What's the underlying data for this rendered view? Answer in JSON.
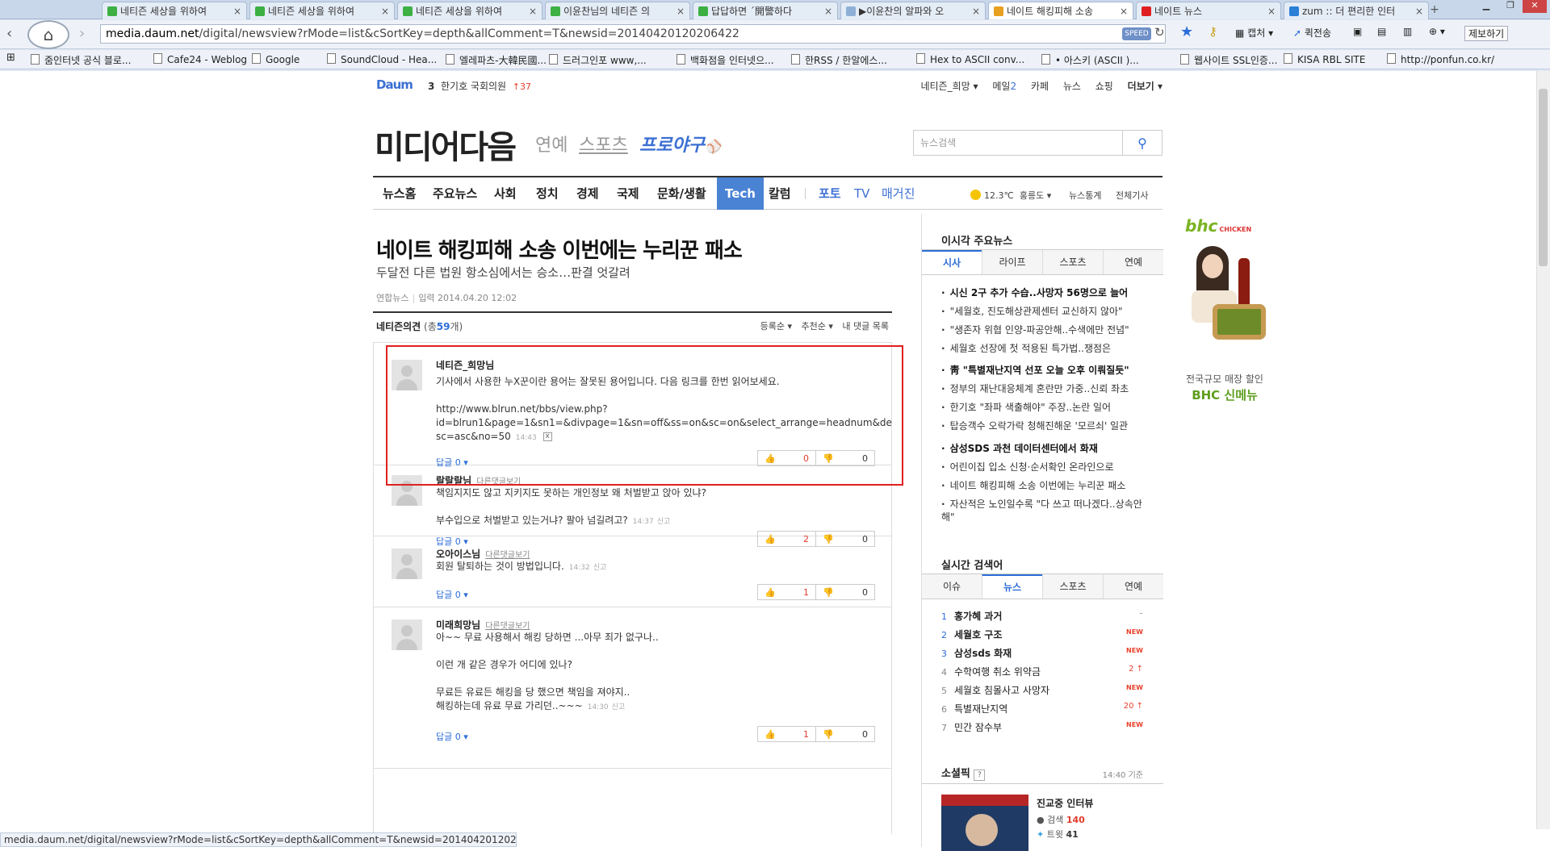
{
  "browser": {
    "tabs": [
      {
        "title": "네티즌 세상을 위하여",
        "color": "#3cb043"
      },
      {
        "title": "네티즌 세상을 위하여",
        "color": "#3cb043"
      },
      {
        "title": "네티즌 세상을 위하여",
        "color": "#3cb043"
      },
      {
        "title": "이윤찬님의 네티즌 의",
        "color": "#3cb043"
      },
      {
        "title": "답답하면 ´開警하다",
        "color": "#3cb043"
      },
      {
        "title": "▶이윤찬의 알파와 오",
        "color": "#8fb0d6"
      },
      {
        "title": "네이트 해킹피해 소송",
        "color": "#e8a020"
      },
      {
        "title": "네이트 뉴스",
        "color": "#e02020"
      },
      {
        "title": "zum :: 더 편리한 인터",
        "color": "#2a7fd6"
      }
    ],
    "url_host": "media.daum.net",
    "url_path": "/digital/newsview?rMode=list&cSortKey=depth&allComment=T&newsid=20140420120206422",
    "speed_label": "SPEED",
    "toolbar": {
      "capture": "캡처",
      "quick_send": "퀵전송",
      "report": "제보하기"
    },
    "bookmarks": [
      "줌인터넷 공식 블로...",
      "Cafe24 - Weblog",
      "Google",
      "SoundCloud - Hea...",
      "엘레파츠-大韓民國...",
      "드러그인포 www,...",
      "백화점을 인터넷으...",
      "한RSS / 한알에스...",
      "Hex to ASCII conv...",
      "• 아스키 (ASCII )...",
      "웹사이트 SSL인증...",
      "KISA RBL SITE",
      "http://ponfun.co.kr/"
    ],
    "status_url": "media.daum.net/digital/newsview?rMode=list&cSortKey=depth&allComment=T&newsid=20140420120206422#"
  },
  "daum": {
    "logo": "Daum",
    "issue_rank": "3",
    "issue_text": "한기호 국회의원",
    "issue_change": "↑37",
    "toplinks": {
      "user": "네티즌_희망 ▾",
      "mail": "메일",
      "mail_count": "2",
      "cafe": "카페",
      "news": "뉴스",
      "shopping": "쇼핑",
      "more": "더보기 ▾"
    }
  },
  "brand": {
    "title": "미디어다음",
    "entertainment": "연예",
    "sports": "스포츠",
    "baseball": "프로야구"
  },
  "search": {
    "placeholder": "뉴스검색"
  },
  "gnb": {
    "items": [
      "뉴스홈",
      "주요뉴스",
      "사회",
      "정치",
      "경제",
      "국제",
      "문화/생활",
      "Tech",
      "칼럼",
      "포토",
      "TV",
      "매거진"
    ],
    "weather": "12.3℃",
    "region": "홍릉도 ▾",
    "stats": "뉴스통계",
    "all": "전체기사"
  },
  "article": {
    "title": "네이트 해킹피해 소송 이번에는 누리꾼 패소",
    "subtitle": "두달전 다른 법원 항소심에서는 승소…판결 엇갈려",
    "source": "연합뉴스",
    "date_label": "입력",
    "date": "2014.04.20 12:02"
  },
  "comments_header": {
    "label": "네티즌의견",
    "count_prefix": "(총",
    "count": "59",
    "count_suffix": "개)",
    "sort_reg": "등록순 ▾",
    "sort_rec": "추천순 ▾",
    "my": "내 댓글 목록"
  },
  "comments": [
    {
      "name": "네티즌_희망님",
      "more": "",
      "text": "기사에서 사용한 누X꾼이란 용어는 잘못된 용어입니다. 다음 링크를 한번 읽어보세요.\n\nhttp://www.blrun.net/bbs/view.php?\nid=blrun1&page=1&sn1=&divpage=1&sn=off&ss=on&sc=on&select_arrange=headnum&de\nsc=asc&no=50",
      "time": "14:43",
      "tail": "x",
      "reply": "답글 0 ▾",
      "up": "0",
      "down": "0"
    },
    {
      "name": "랄랄랄님",
      "more": "다른댓글보기",
      "text": "책임지지도 않고 지키지도 못하는 개인정보 왜 처벌받고 앉아 있냐?\n\n부수입으로 처벌받고 있는거냐? 팔아 넘길려고?",
      "time": "14:37",
      "tail": "신고",
      "reply": "답글 0 ▾",
      "up": "2",
      "down": "0"
    },
    {
      "name": "오아이스님",
      "more": "다른댓글보기",
      "text": "회원 탈퇴하는 것이 방법입니다.",
      "time": "14:32",
      "tail": "신고",
      "reply": "답글 0 ▾",
      "up": "1",
      "down": "0"
    },
    {
      "name": "미래희망님",
      "more": "다른댓글보기",
      "text": "아~~ 무료 사용해서 해킹 당하면 ...아무 죄가 없구나..\n\n이런 개 같은 경우가 어디에 있나?\n\n무료든 유료든 해킹을 당 했으면 책임을 져야지..\n해킹하는데 유료 무료 가리던..~~~",
      "time": "14:30",
      "tail": "신고",
      "reply": "답글 0 ▾",
      "up": "1",
      "down": "0"
    }
  ],
  "sidebar": {
    "top_news_title": "이시각 주요뉴스",
    "top_news_tabs": [
      "시사",
      "라이프",
      "스포츠",
      "연예"
    ],
    "top_news": [
      {
        "text": "시신 2구 추가 수습..사망자 56명으로 늘어",
        "bold": true
      },
      {
        "text": "\"세월호, 진도해상관제센터 교신하지 않아\"",
        "bold": false
      },
      {
        "text": "\"생존자 위협 인양-파공안해..수색에만 전념\"",
        "bold": false
      },
      {
        "text": "세월호 선장에 첫 적용된 특가법..쟁점은",
        "bold": false
      },
      {
        "text": "靑 \"특별재난지역 선포 오늘 오후 이뤄질듯\"",
        "bold": true
      },
      {
        "text": "정부의 재난대응체계 혼란만 가중..신뢰 좌초",
        "bold": false
      },
      {
        "text": "한기호 \"좌파 색출해야\" 주장..논란 일어",
        "bold": false
      },
      {
        "text": "탑승객수 오락가락 청해진해운 '모르쇠' 일관",
        "bold": false
      },
      {
        "text": "삼성SDS 과천 데이터센터에서 화재",
        "bold": true
      },
      {
        "text": "어린이집 입소 신청·순서확인 온라인으로",
        "bold": false
      },
      {
        "text": "네이트 해킹피해 소송 이번에는 누리꾼 패소",
        "bold": false
      },
      {
        "text": "자산적은 노인일수록 \"다 쓰고 떠나겠다..상속안해\"",
        "bold": false
      }
    ],
    "realtime_title": "실시간 검색어",
    "realtime_tabs": [
      "이슈",
      "뉴스",
      "스포츠",
      "연예"
    ],
    "realtime": [
      {
        "rank": "1",
        "text": "홍가혜 과거",
        "status": "–",
        "bold": true
      },
      {
        "rank": "2",
        "text": "세월호 구조",
        "status": "NEW",
        "bold": true
      },
      {
        "rank": "3",
        "text": "삼성sds 화재",
        "status": "NEW",
        "bold": true
      },
      {
        "rank": "4",
        "text": "수학여행 취소 위약금",
        "status": "2 ↑",
        "bold": false
      },
      {
        "rank": "5",
        "text": "세월호 침몰사고 사망자",
        "status": "NEW",
        "bold": false
      },
      {
        "rank": "6",
        "text": "특별재난지역",
        "status": "20 ↑",
        "bold": false
      },
      {
        "rank": "7",
        "text": "민간 잠수부",
        "status": "NEW",
        "bold": false
      }
    ],
    "sosul_title": "소셜픽",
    "sosul_help": "?",
    "sosul_time": "14:40 기준",
    "sosul_item": "진교중 인터뷰",
    "sosul_search_label": "검색",
    "sosul_search": "140",
    "sosul_tweet_label": "트윗",
    "sosul_tweet": "41"
  },
  "ad": {
    "brand": "bhc",
    "brand_sub": "CHICKEN",
    "line1": "전국규모 매장 할인",
    "line2": "BHC 신메뉴"
  }
}
